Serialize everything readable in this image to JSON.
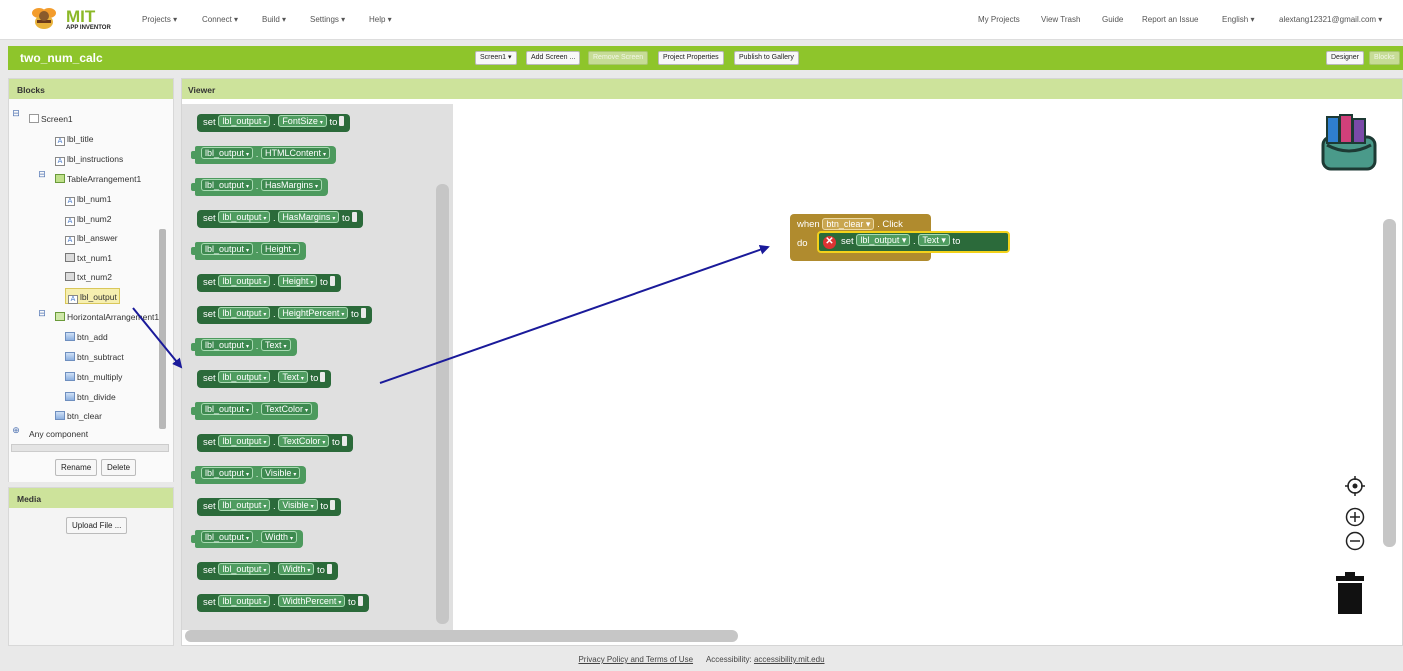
{
  "topbar": {
    "logo_main": "MIT",
    "logo_sub": "APP INVENTOR",
    "menus": [
      "Projects ▾",
      "Connect ▾",
      "Build ▾",
      "Settings ▾",
      "Help ▾"
    ],
    "right": [
      "My Projects",
      "View Trash",
      "Guide",
      "Report an Issue",
      "English ▾",
      "alextang12321@gmail.com ▾"
    ]
  },
  "project": {
    "name": "two_num_calc",
    "screen_select": "Screen1 ▾",
    "add_screen": "Add Screen ...",
    "remove_screen": "Remove Screen",
    "properties": "Project Properties",
    "publish": "Publish to Gallery",
    "designer": "Designer",
    "blocks": "Blocks"
  },
  "blocks_panel": {
    "title": "Blocks",
    "tree": {
      "screen": "Screen1",
      "lbl_title": "lbl_title",
      "lbl_instructions": "lbl_instructions",
      "table": "TableArrangement1",
      "lbl_num1": "lbl_num1",
      "lbl_num2": "lbl_num2",
      "lbl_answer": "lbl_answer",
      "txt_num1": "txt_num1",
      "txt_num2": "txt_num2",
      "lbl_output": "lbl_output",
      "horizontal": "HorizontalArrangement1",
      "btn_add": "btn_add",
      "btn_subtract": "btn_subtract",
      "btn_multiply": "btn_multiply",
      "btn_divide": "btn_divide",
      "btn_clear": "btn_clear",
      "any": "Any component"
    },
    "rename": "Rename",
    "delete": "Delete"
  },
  "media_panel": {
    "title": "Media",
    "upload": "Upload File ..."
  },
  "viewer": {
    "title": "Viewer",
    "component": "lbl_output",
    "kw_set": "set",
    "kw_to": "to",
    "dot": ".",
    "props": {
      "fontsize": "FontSize",
      "htmlcontent": "HTMLContent",
      "hasmargins": "HasMargins",
      "height": "Height",
      "heightpercent": "HeightPercent",
      "text": "Text",
      "textcolor": "TextColor",
      "visible": "Visible",
      "width": "Width",
      "widthpercent": "WidthPercent"
    },
    "event": {
      "when": "when",
      "component": "btn_clear",
      "event": "Click",
      "do": "do"
    }
  },
  "footer": {
    "privacy": "Privacy Policy and Terms of Use",
    "accessibility_label": "Accessibility:",
    "accessibility_link": "accessibility.mit.edu"
  },
  "colors": {
    "green_bar": "#8ec52b",
    "block_dark": "#2b6a3a",
    "event_block": "#b08b2e",
    "arrow": "#1a1a9a"
  },
  "icons": [
    "bee-logo-icon",
    "backpack-icon",
    "center-target-icon",
    "zoom-in-icon",
    "zoom-out-icon",
    "trash-icon",
    "error-x-icon"
  ]
}
